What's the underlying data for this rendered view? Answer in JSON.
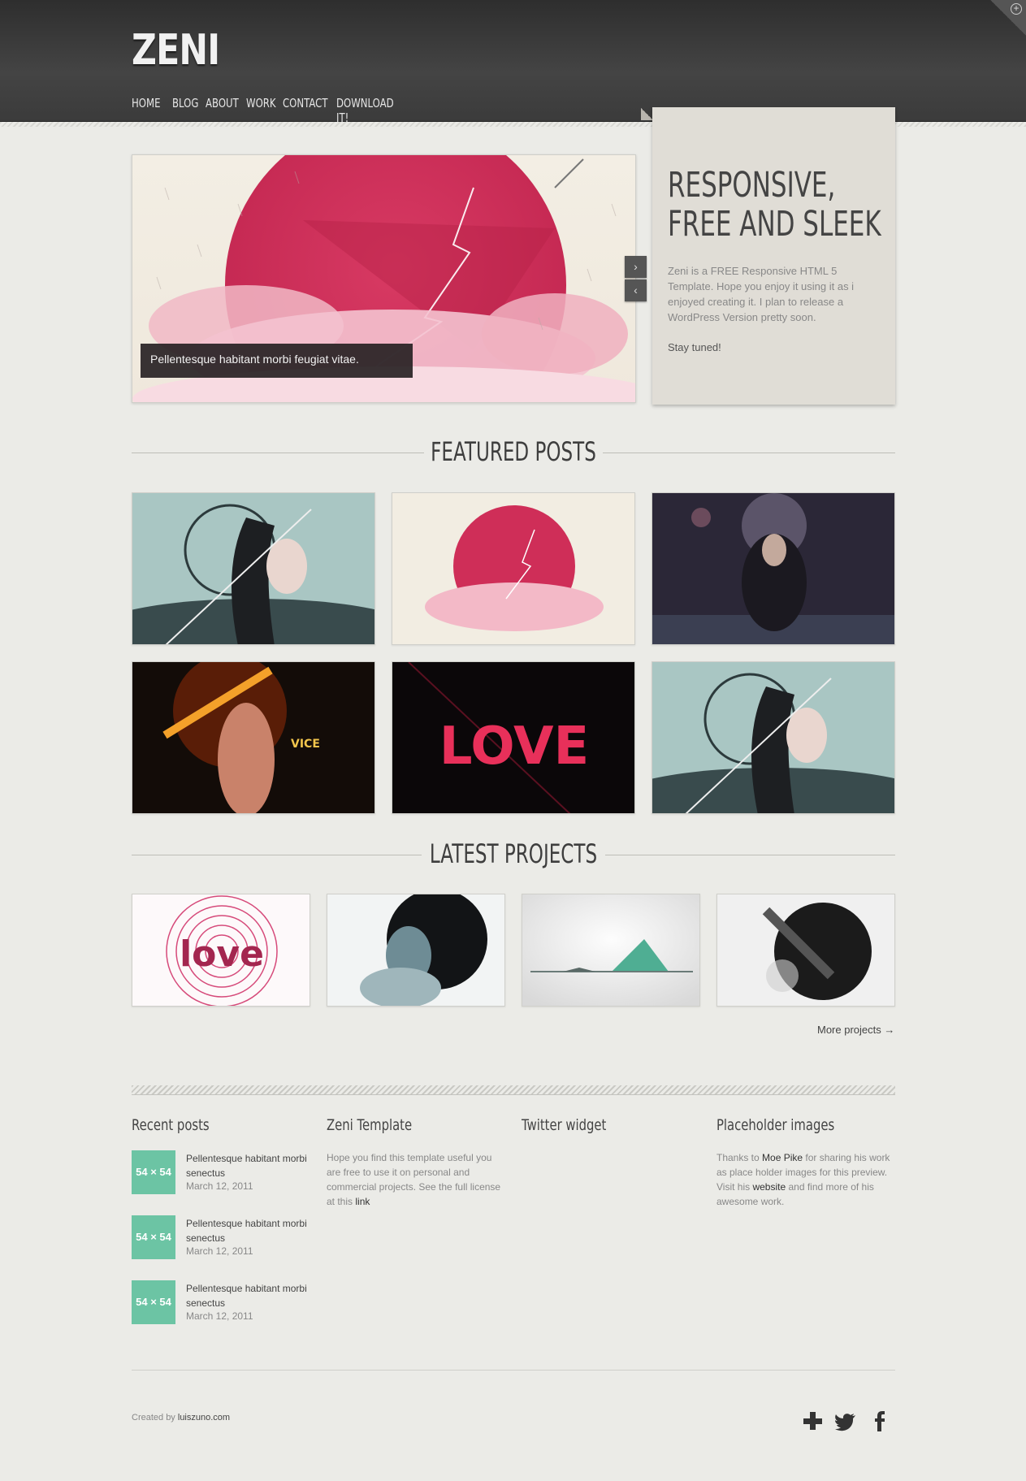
{
  "header": {
    "logo": "ZENI",
    "nav": [
      "HOME",
      "BLOG",
      "ABOUT",
      "WORK",
      "CONTACT",
      "DOWNLOAD IT!"
    ],
    "active_nav": "HOME"
  },
  "hero": {
    "caption": "Pellentesque habitant morbi feugiat vitae.",
    "next_icon": "chevron-right-icon",
    "prev_icon": "chevron-left-icon"
  },
  "promo": {
    "title": "RESPONSIVE, FREE AND SLEEK",
    "text": "Zeni is a FREE Responsive HTML 5 Template. Hope you enjoy it using it as i enjoyed creating it. I plan to release a WordPress Version pretty soon.",
    "cta": "Stay tuned!"
  },
  "featured": {
    "title": "FEATURED POSTS"
  },
  "projects": {
    "title": "LATEST PROJECTS",
    "more": "More projects →"
  },
  "widgets": {
    "recent": {
      "title": "Recent posts",
      "posts": [
        {
          "thumb": "54 × 54",
          "title": "Pellentesque habitant morbi senectus",
          "date": "March 12, 2011"
        },
        {
          "thumb": "54 × 54",
          "title": "Pellentesque habitant morbi senectus",
          "date": "March 12, 2011"
        },
        {
          "thumb": "54 × 54",
          "title": "Pellentesque habitant morbi senectus",
          "date": "March 12, 2011"
        }
      ]
    },
    "template": {
      "title": "Zeni Template",
      "text": "Hope you find this template useful you are free to use it on personal and commercial projects. See the full license at this ",
      "link": "link"
    },
    "twitter": {
      "title": "Twitter widget"
    },
    "placeholder": {
      "title": "Placeholder images",
      "text_before": "Thanks to ",
      "author": "Moe Pike",
      "text_mid": " for sharing his work as place holder images for this preview. Visit his ",
      "website": "website",
      "text_after": " and find more of his awesome work."
    }
  },
  "footer": {
    "created_by": "Created by ",
    "author_link": "luiszuno.com",
    "social": [
      "plus-icon",
      "twitter-icon",
      "facebook-icon"
    ]
  },
  "colors": {
    "accent": "#6cc4a4",
    "header": "#3b3b3b",
    "background": "#ebebe7",
    "hero_red": "#d9335c"
  }
}
